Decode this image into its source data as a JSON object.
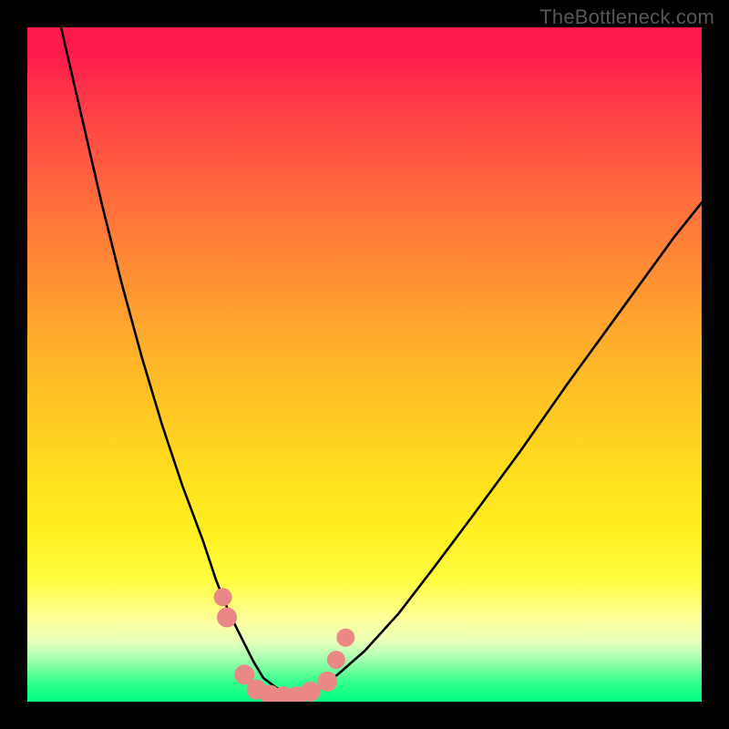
{
  "watermark": "TheBottleneck.com",
  "chart_data": {
    "type": "line",
    "title": "",
    "xlabel": "",
    "ylabel": "",
    "xlim": [
      0,
      100
    ],
    "ylim": [
      0,
      100
    ],
    "background_gradient": {
      "direction": "top-to-bottom",
      "stops": [
        {
          "pos": 0,
          "color": "#ff1a4d",
          "meaning": "severe bottleneck"
        },
        {
          "pos": 35,
          "color": "#ff8a35"
        },
        {
          "pos": 67,
          "color": "#ffe01e"
        },
        {
          "pos": 88,
          "color": "#fdff9e"
        },
        {
          "pos": 100,
          "color": "#00ff80",
          "meaning": "no bottleneck"
        }
      ]
    },
    "series": [
      {
        "name": "bottleneck-curve",
        "stroke": "#000000",
        "x": [
          5,
          8,
          11,
          14,
          17,
          20,
          23,
          26,
          28,
          30,
          32,
          33.5,
          35,
          37,
          39,
          41,
          43,
          46,
          50,
          55,
          60,
          66,
          73,
          80,
          88,
          96,
          100
        ],
        "y_pct_from_top": [
          0,
          13,
          26,
          38,
          49,
          59,
          68,
          76,
          82,
          87,
          91,
          94,
          96.5,
          98,
          98.8,
          98.8,
          98,
          96,
          92.5,
          87,
          80.5,
          72.5,
          63,
          53,
          42,
          31,
          26
        ]
      }
    ],
    "markers": [
      {
        "x": 29.0,
        "y_pct_from_top": 84.5,
        "r": 10,
        "color": "#e98884"
      },
      {
        "x": 29.6,
        "y_pct_from_top": 87.5,
        "r": 11,
        "color": "#e98884"
      },
      {
        "x": 32.2,
        "y_pct_from_top": 96.0,
        "r": 11,
        "color": "#e98884"
      },
      {
        "x": 34.0,
        "y_pct_from_top": 98.2,
        "r": 11,
        "color": "#e98884"
      },
      {
        "x": 36.0,
        "y_pct_from_top": 99.0,
        "r": 11,
        "color": "#e98884"
      },
      {
        "x": 38.0,
        "y_pct_from_top": 99.2,
        "r": 11,
        "color": "#e98884"
      },
      {
        "x": 40.0,
        "y_pct_from_top": 99.2,
        "r": 11,
        "color": "#e98884"
      },
      {
        "x": 42.0,
        "y_pct_from_top": 98.5,
        "r": 11,
        "color": "#e98884"
      },
      {
        "x": 44.5,
        "y_pct_from_top": 97.0,
        "r": 11,
        "color": "#e98884"
      },
      {
        "x": 45.8,
        "y_pct_from_top": 93.8,
        "r": 10,
        "color": "#e98884"
      },
      {
        "x": 47.2,
        "y_pct_from_top": 90.5,
        "r": 10,
        "color": "#e98884"
      }
    ]
  },
  "colors": {
    "frame": "#000000",
    "watermark": "#575757",
    "marker_fill": "#e98884"
  }
}
